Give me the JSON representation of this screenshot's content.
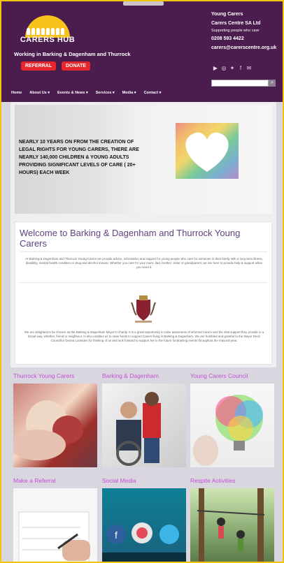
{
  "header": {
    "logo_text": "CARERS HUB",
    "tagline": "Working in Barking & Dagenham and Thurrock",
    "referral_label": "REFERRAL",
    "donate_label": "DONATE",
    "contact": {
      "org": "Young Carers",
      "org2": "Carers Centre SA Ltd",
      "support": "Supporting people who care",
      "phone": "0208 593 4422",
      "email": "carers@carerscentre.org.uk"
    },
    "socials": [
      "youtube-icon",
      "instagram-icon",
      "twitter-icon",
      "facebook-icon",
      "email-icon"
    ],
    "nav": [
      "Home",
      "About Us ▾",
      "Events & News ▾",
      "Services ▾",
      "Media ▾",
      "Contact ▾"
    ],
    "search_placeholder": ""
  },
  "banner": {
    "text": "NEARLY 10 YEARS ON FROM THE CREATION OF LEGAL RIGHTS FOR YOUNG CARERS, THERE ARE NEARLY 140,000 CHILDREN & YOUNG ADULTS PROVIDING SIGNIFICANT LEVELS OF CARE ( 20+ HOURS) EACH WEEK"
  },
  "welcome": {
    "title": "Welcome to Barking & Dagenham and Thurrock Young Carers",
    "intro": "At Barking & Dagenham and Thurrock Young Carers we provide advice, information and support for young people who care for someone in their family with a long-term illness, disability, mental health condition or drug and alcohol misuse. Whether you care for your mum, dad, brother, sister or grandparent, we are here to provide help & support when you need it.",
    "footer": "We are delighted to be chosen as the Barking & Dagenham Mayor's Charity. It is a great opportunity to raise awareness of informal Carers and the vital support they provide in a broad way, whether, friend or neighbour, in also enables us to raise funds to support Carers living in Barking & Dagenham. We are humbled and grateful to the Mayor Deck Councillor Donna Lumsden for thinking of us and look forward to support her in the future fundraising events throughout the mayoral year."
  },
  "sections": [
    {
      "title": "Thurrock Young Carers"
    },
    {
      "title": "Barking & Dagenham"
    },
    {
      "title": "Young Carers Council"
    },
    {
      "title": "Make a Referral"
    },
    {
      "title": "Social Media"
    },
    {
      "title": "Respite Activities"
    }
  ],
  "colors": {
    "brand": "#4b1d4f",
    "accent": "#c54fd7",
    "button": "#e7252c",
    "sun": "#f7c21c"
  }
}
